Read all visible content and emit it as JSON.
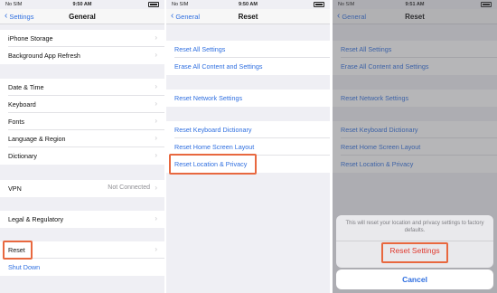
{
  "panel1": {
    "status": {
      "carrier": "No SIM",
      "time": "9:50 AM"
    },
    "back_label": "Settings",
    "title": "General",
    "rows": [
      {
        "label": "iPhone Storage"
      },
      {
        "label": "Background App Refresh"
      },
      {
        "label": "Date & Time"
      },
      {
        "label": "Keyboard"
      },
      {
        "label": "Fonts"
      },
      {
        "label": "Language & Region"
      },
      {
        "label": "Dictionary"
      },
      {
        "label": "VPN",
        "value": "Not Connected"
      },
      {
        "label": "Legal & Regulatory"
      },
      {
        "label": "Reset"
      },
      {
        "label": "Shut Down"
      }
    ]
  },
  "panel2": {
    "status": {
      "carrier": "No SIM",
      "time": "9:50 AM"
    },
    "back_label": "General",
    "title": "Reset",
    "rows": [
      {
        "label": "Reset All Settings"
      },
      {
        "label": "Erase All Content and Settings"
      },
      {
        "label": "Reset Network Settings"
      },
      {
        "label": "Reset Keyboard Dictionary"
      },
      {
        "label": "Reset Home Screen Layout"
      },
      {
        "label": "Reset Location & Privacy"
      }
    ]
  },
  "panel3": {
    "status": {
      "carrier": "No SIM",
      "time": "9:51 AM"
    },
    "back_label": "General",
    "title": "Reset",
    "rows": [
      {
        "label": "Reset All Settings"
      },
      {
        "label": "Erase All Content and Settings"
      },
      {
        "label": "Reset Network Settings"
      },
      {
        "label": "Reset Keyboard Dictionary"
      },
      {
        "label": "Reset Home Screen Layout"
      },
      {
        "label": "Reset Location & Privacy"
      }
    ],
    "sheet": {
      "message": "This will reset your location and privacy settings to factory defaults.",
      "action_label": "Reset Settings",
      "cancel_label": "Cancel"
    }
  },
  "colors": {
    "accent": "#2f6fe0",
    "destructive": "#e03a2f",
    "highlight": "#e8683f",
    "background": "#efeff4"
  },
  "icons": {
    "back": "chevron-left-icon",
    "disclosure": "chevron-right-icon",
    "battery": "battery-icon"
  }
}
